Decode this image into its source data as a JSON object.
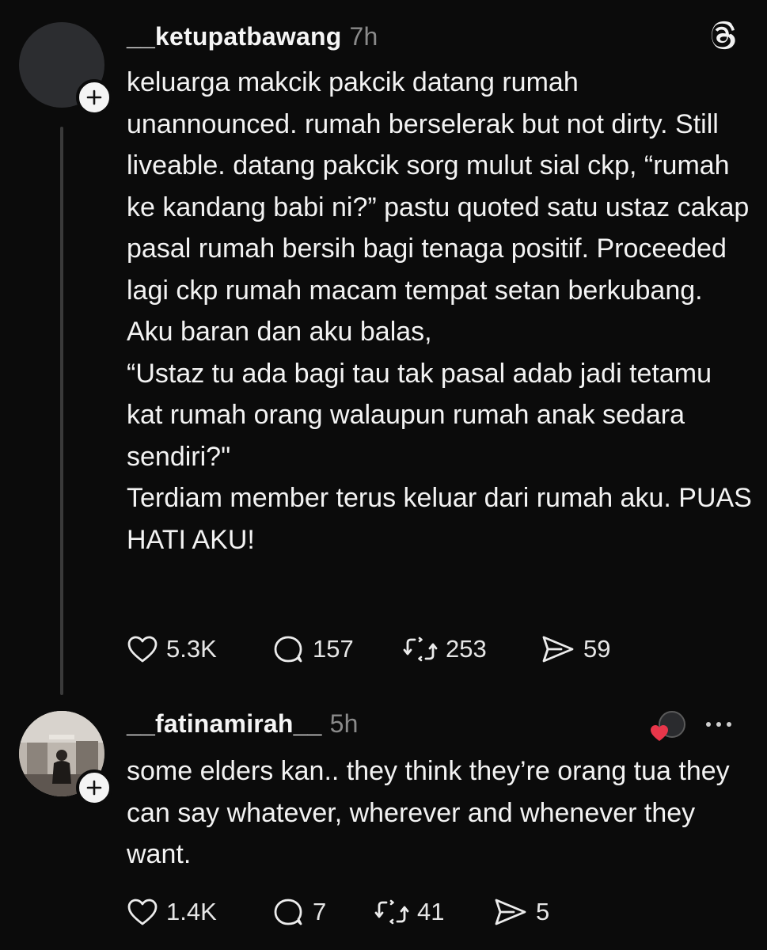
{
  "app": {
    "logo_icon": "threads-logo-icon",
    "accent_like": "#e8364a"
  },
  "posts": [
    {
      "username": "__ketupatbawang",
      "time": "7h",
      "paragraphs": [
        "keluarga makcik pakcik datang rumah unannounced. rumah berselerak but not dirty. Still liveable. datang pakcik sorg mulut sial ckp, “rumah ke kandang babi ni?” pastu quoted satu ustaz cakap pasal rumah bersih bagi tenaga positif. Proceeded lagi ckp rumah macam tempat setan berkubang.",
        "Aku baran dan aku balas,",
        "“Ustaz tu ada bagi tau tak pasal adab jadi tetamu kat rumah orang walaupun rumah anak sedara sendiri?\"",
        "Terdiam member terus keluar dari rumah aku. PUAS HATI AKU!"
      ],
      "likes": "5.3K",
      "replies": "157",
      "reposts": "253",
      "shares": "59"
    },
    {
      "username": "__fatinamirah__",
      "time": "5h",
      "paragraphs": [
        "some elders kan.. they think they’re orang tua they can say whatever, wherever and whenever they want."
      ],
      "likes": "1.4K",
      "replies": "7",
      "reposts": "41",
      "shares": "5",
      "liked_by_author": true
    }
  ]
}
